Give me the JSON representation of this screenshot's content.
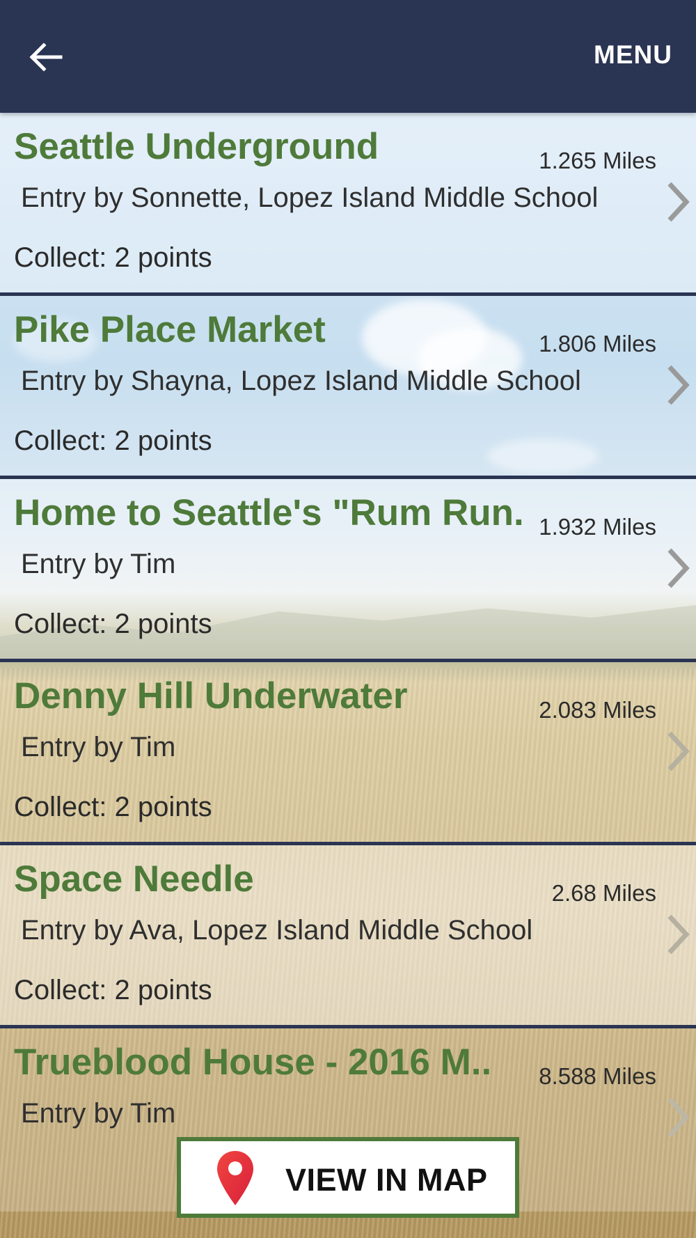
{
  "header": {
    "menu_label": "MENU"
  },
  "entries": [
    {
      "title": "Seattle Underground",
      "distance": "1.265  Miles",
      "entry": "Entry by Sonnette, Lopez Island Middle School",
      "collect": "Collect: 2 points"
    },
    {
      "title": "Pike Place Market",
      "distance": "1.806  Miles",
      "entry": "Entry by Shayna, Lopez Island Middle School",
      "collect": "Collect: 2 points"
    },
    {
      "title": "Home to Seattle's \"Rum Run..",
      "distance": "1.932  Miles",
      "entry": "Entry by Tim",
      "collect": "Collect: 2 points"
    },
    {
      "title": "Denny Hill Underwater",
      "distance": "2.083  Miles",
      "entry": "Entry by Tim",
      "collect": "Collect: 2 points"
    },
    {
      "title": "Space Needle",
      "distance": "2.68  Miles",
      "entry": "Entry by Ava, Lopez Island Middle School",
      "collect": "Collect: 2 points"
    },
    {
      "title": "Trueblood House - 2016 M..",
      "distance": "8.588  Miles",
      "entry": "Entry by Tim",
      "collect": ""
    }
  ],
  "map_button": {
    "label": "VIEW IN MAP",
    "icon": "map-pin-icon"
  },
  "colors": {
    "appbar": "#2a3453",
    "title_green": "#4e7a3a",
    "pin_red": "#e8313a"
  }
}
